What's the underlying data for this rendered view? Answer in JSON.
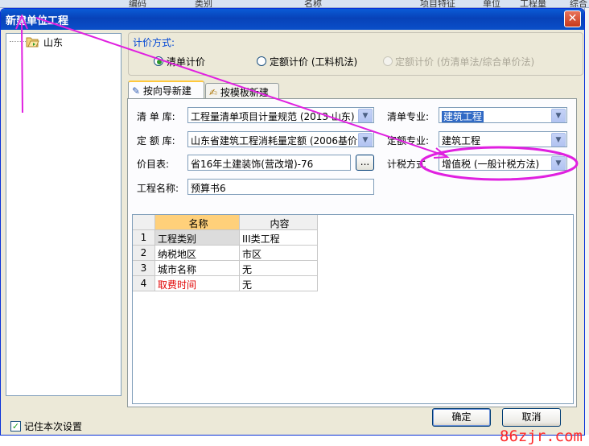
{
  "background": {
    "header_labels": [
      "编码",
      "类别",
      "名称",
      "项目特征",
      "单位",
      "工程量",
      "综合"
    ]
  },
  "dialog": {
    "title": "新建单位工程",
    "close_glyph": "✕",
    "tree": {
      "root_label": "山东"
    },
    "pricing_method": {
      "legend": "计价方式:",
      "options": [
        {
          "label": "清单计价",
          "selected": true,
          "enabled": true
        },
        {
          "label": "定额计价 (工料机法)",
          "selected": false,
          "enabled": true
        },
        {
          "label": "定额计价 (仿清单法/综合单价法)",
          "selected": false,
          "enabled": false
        }
      ]
    },
    "tabs": [
      {
        "label": "按向导新建",
        "active": true
      },
      {
        "label": "按模板新建",
        "active": false
      }
    ],
    "form": {
      "bill_lib_label": "清 单 库:",
      "bill_lib_value": "工程量清单项目计量规范 (2013 山东)",
      "bill_spec_label": "清单专业:",
      "bill_spec_value": "建筑工程",
      "quota_lib_label": "定 额 库:",
      "quota_lib_value": "山东省建筑工程消耗量定额 (2006基价)",
      "quota_spec_label": "定额专业:",
      "quota_spec_value": "建筑工程",
      "price_list_label": "价目表:",
      "price_list_value": "省16年土建装饰(营改增)-76",
      "browse_label": "...",
      "tax_method_label": "计税方式",
      "tax_method_value": "增值税 (一般计税方法)",
      "project_name_label": "工程名称:",
      "project_name_value": "预算书6"
    },
    "grid": {
      "headers": [
        "名称",
        "内容"
      ],
      "rows": [
        {
          "num": "1",
          "name": "工程类别",
          "content": "III类工程",
          "highlight": false
        },
        {
          "num": "2",
          "name": "纳税地区",
          "content": "市区",
          "highlight": false
        },
        {
          "num": "3",
          "name": "城市名称",
          "content": "无",
          "highlight": false
        },
        {
          "num": "4",
          "name": "取费时间",
          "content": "无",
          "highlight": true
        }
      ]
    },
    "remember_label": "记住本次设置",
    "remember_checked": true,
    "ok_label": "确定",
    "cancel_label": "取消"
  },
  "watermark": "86zjr.com",
  "colors": {
    "annotation": "#e020e0",
    "highlight_text": "#e00000",
    "title_bar": "#0a4fc9"
  }
}
